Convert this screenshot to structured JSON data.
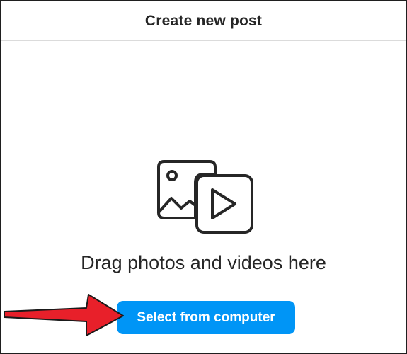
{
  "dialog": {
    "title": "Create new post",
    "prompt": "Drag photos and videos here",
    "select_button_label": "Select from computer"
  },
  "icons": {
    "media": "photo-video-icon",
    "annotation": "red-arrow"
  },
  "colors": {
    "button_bg": "#0095f6",
    "button_text": "#ffffff",
    "arrow": "#e8202a",
    "text": "#262626"
  }
}
